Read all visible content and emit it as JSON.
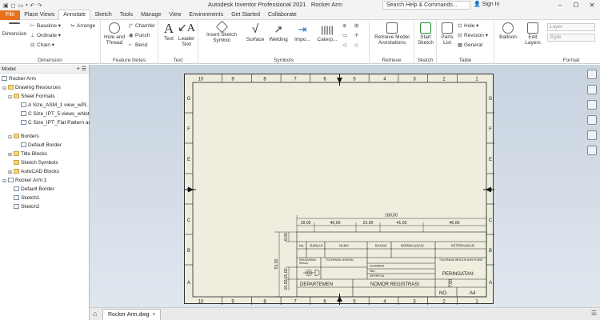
{
  "window": {
    "app_title": "Autodesk Inventor Professional 2021",
    "doc_title": "Rocker Arm",
    "search_placeholder": "Search Help & Commands...",
    "signin": "Sign In"
  },
  "tabs": [
    "File",
    "Place Views",
    "Annotate",
    "Sketch",
    "Tools",
    "Manage",
    "View",
    "Environments",
    "Get Started",
    "Collaborate"
  ],
  "ribbon": {
    "dimension": {
      "main": "Dimension",
      "baseline": "Baseline",
      "ordinate": "Ordinate",
      "chain": "Chain",
      "arrange": "Arrange",
      "label": "Dimension"
    },
    "feature_notes": {
      "hole_thread": "Hole and Thread",
      "chamfer": "Chamfer",
      "punch": "Punch",
      "bend": "Bend",
      "label": "Feature Notes"
    },
    "text": {
      "text": "Text",
      "leader_text": "Leader Text",
      "label": "Text"
    },
    "symbols": {
      "insert_sketch_symbol": "Insert Sketch Symbol",
      "surface": "Surface",
      "welding": "Welding",
      "import": "Impo...",
      "caterpillar": "Caterp...",
      "label": "Symbols"
    },
    "retrieve": {
      "retrieve_model_annotations": "Retrieve Model Annotations",
      "label": "Retrieve"
    },
    "sketch": {
      "start_sketch": "Start Sketch",
      "label": "Sketch"
    },
    "table": {
      "parts_list": "Parts List",
      "hole": "Hole",
      "revision": "Revision",
      "general": "General",
      "label": "Table"
    },
    "balloon": {
      "balloon": "Balloon"
    },
    "edit_layers": {
      "edit_layers": "Edit Layers"
    },
    "format": {
      "layer_placeholder": "Layer",
      "style_placeholder": "Style",
      "label": "Format"
    }
  },
  "browser": {
    "tab_label": "Model",
    "root": "Rocker Arm",
    "items": {
      "drawing_resources": "Drawing Resources",
      "sheet_formats": "Sheet Formats",
      "sf1": "A Size_ASM_1 view_wPL",
      "sf2": "C Size_IPT_5 views_wNote",
      "sf3": "C Size_IPT_Flat Pattern and",
      "borders": "Borders",
      "default_border": "Default Border",
      "title_blocks": "Title Blocks",
      "sketch_symbols": "Sketch Symbols",
      "autocad_blocks": "AutoCAD Blocks",
      "sheet": "Rocker Arm:1",
      "sheet_border": "Default Border",
      "sketch1": "Sketch1",
      "sketch2": "Sketch2"
    }
  },
  "drawing": {
    "zone_cols": [
      "10",
      "9",
      "8",
      "7",
      "6",
      "5",
      "4",
      "3",
      "2",
      "1"
    ],
    "zone_rows": [
      "G",
      "F",
      "E",
      "D",
      "C",
      "B",
      "A"
    ],
    "dims": {
      "overall": "180,00",
      "d1": "18,00",
      "d2": "40,00",
      "d3": "23,00",
      "d4": "41,00",
      "d5": "46,00",
      "h1": "8,00",
      "h2": "53,00",
      "h3": "15,00",
      "h4": "10,00",
      "h5": "7,00"
    },
    "title_block": {
      "no": "No.",
      "jumlah": "JUMLAH",
      "nama": "NAMA",
      "bahan": "BAHAN",
      "normalisasi": "NORMALISASI",
      "keterangan": "KETERANGAN",
      "toleransi_bentuk": "TOLERANSI BENTUK DAN POSISI",
      "kekasaran": "KEKASARAN",
      "skala": "SKALA",
      "toleransi_ukuran": "TOLERANSI UKURAN",
      "digambar": "DIGAMBAR :",
      "nim": "NIM :",
      "diperiksa": "DIPERIKSA :",
      "peringatan": "PERINGATAN:",
      "departemen": "DEPARTEMEN",
      "nomor_registrasi": "NOMOR REGISTRASI",
      "no2": "NO.",
      "size": "A4"
    }
  },
  "doc_tab": {
    "name": "Rocker Arm.dwg"
  }
}
